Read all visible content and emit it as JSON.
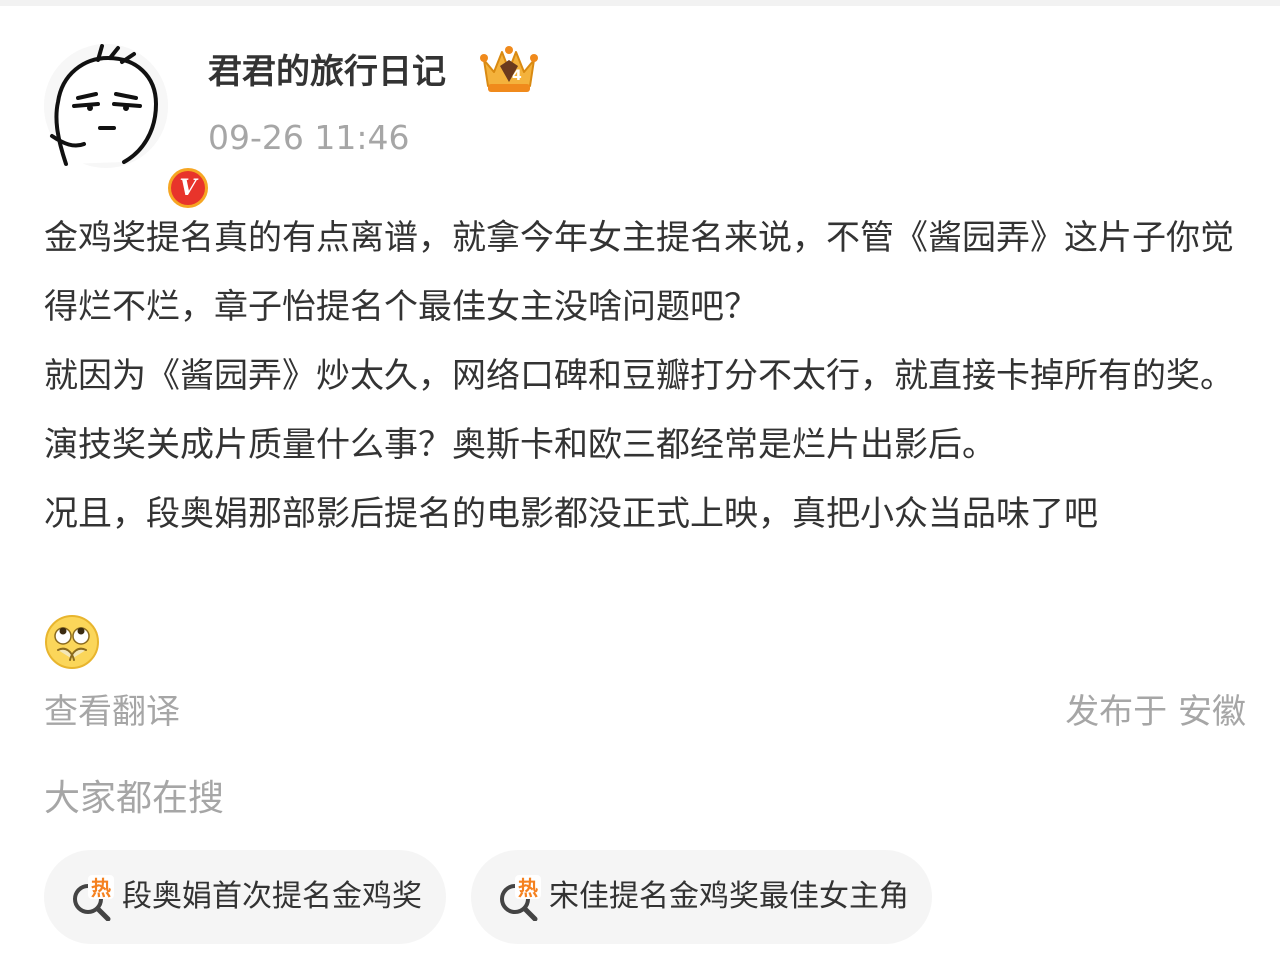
{
  "post": {
    "author": {
      "name": "君君的旅行日记",
      "verified_badge": "V",
      "avatar_icon": "cartoon-face-avatar",
      "crown_icon": "crown-level-badge",
      "crown_level": "4"
    },
    "timestamp": "09-26 11:46",
    "paragraphs": [
      "金鸡奖提名真的有点离谱，就拿今年女主提名来说，不管《酱园弄》这片子你觉得烂不烂，章子怡提名个最佳女主没啥问题吧？",
      "就因为《酱园弄》炒太久，网络口碑和豆瓣打分不太行，就直接卡掉所有的奖。演技奖关成片质量什么事？奥斯卡和欧三都经常是烂片出影后。",
      "况且，段奥娟那部影后提名的电影都没正式上映，真把小众当品味了吧"
    ],
    "emoji_icon": "eye-roll-emoji",
    "translate_label": "查看翻译",
    "location_label": "发布于 安徽"
  },
  "trending": {
    "heading": "大家都在搜",
    "hot_tag": "热",
    "items": [
      {
        "label": "段奥娟首次提名金鸡奖",
        "icon": "hot-search-icon"
      },
      {
        "label": "宋佳提名金鸡奖最佳女主角",
        "icon": "hot-search-icon"
      }
    ]
  },
  "colors": {
    "text_primary": "#333333",
    "text_secondary": "#a6a6a6",
    "pill_background": "#f5f5f5",
    "hot_orange": "#f5811f",
    "verified_red": "#e8342b",
    "verified_ring": "#f6a623"
  }
}
